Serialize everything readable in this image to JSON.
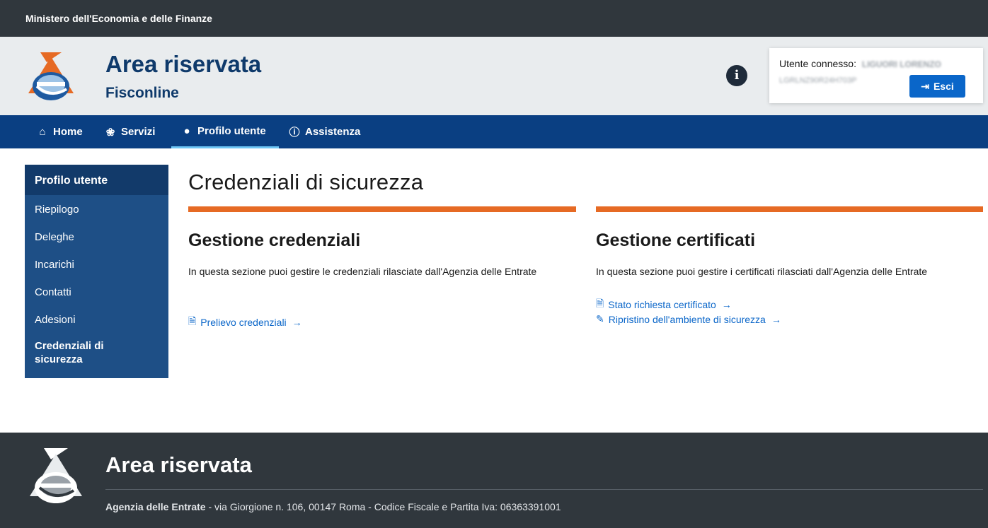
{
  "ministry_bar": {
    "text": "Ministero dell'Economia e delle Finanze"
  },
  "header": {
    "title": "Area riservata",
    "subtitle": "Fisconline",
    "info_icon": "info-circle-icon",
    "user": {
      "label": "Utente connesso:",
      "name": "LIGUORI LORENZO",
      "fiscal_code": "LGRLNZ90R24H703P",
      "logout_label": "Esci",
      "logout_icon": "sign-out-icon"
    }
  },
  "nav": [
    {
      "label": "Home",
      "icon": "home-icon",
      "glyph": "⌂"
    },
    {
      "label": "Servizi",
      "icon": "servizi-icon",
      "glyph": "❀"
    },
    {
      "label": "Profilo utente",
      "icon": "user-icon",
      "glyph": "●",
      "active": true
    },
    {
      "label": "Assistenza",
      "icon": "info-icon",
      "glyph": "ⓘ"
    }
  ],
  "sidebar": {
    "heading": "Profilo utente",
    "items": [
      {
        "label": "Riepilogo"
      },
      {
        "label": "Deleghe"
      },
      {
        "label": "Incarichi"
      },
      {
        "label": "Contatti"
      },
      {
        "label": "Adesioni"
      },
      {
        "label": "Credenziali di sicurezza",
        "active": true
      }
    ]
  },
  "main": {
    "title": "Credenziali di sicurezza",
    "credenziali": {
      "title": "Gestione credenziali",
      "text": "In questa sezione puoi gestire le credenziali rilasciate dall'Agenzia delle Entrate",
      "links": [
        {
          "label": "Prelievo credenziali",
          "icon": "document-icon"
        }
      ]
    },
    "certificati": {
      "title": "Gestione certificati",
      "text": "In questa sezione puoi gestire i certificati rilasciati dall'Agenzia delle Entrate",
      "links": [
        {
          "label": "Stato richiesta certificato",
          "icon": "document-icon"
        },
        {
          "label": "Ripristino dell'ambiente di sicurezza",
          "icon": "edit-icon"
        }
      ]
    }
  },
  "footer": {
    "title": "Area riservata",
    "org": "Agenzia delle Entrate",
    "details": " - via Giorgione n. 106, 00147 Roma - Codice Fiscale e Partita Iva: 06363391001"
  },
  "colors": {
    "ministry_bar": "#30373d",
    "header_bg": "#e9ecee",
    "brand_blue": "#0f3a6b",
    "nav_bg": "#0a3f82",
    "sidebar_bg": "#1e4f86",
    "accent_orange": "#e66a24",
    "link_blue": "#0a66c9"
  }
}
